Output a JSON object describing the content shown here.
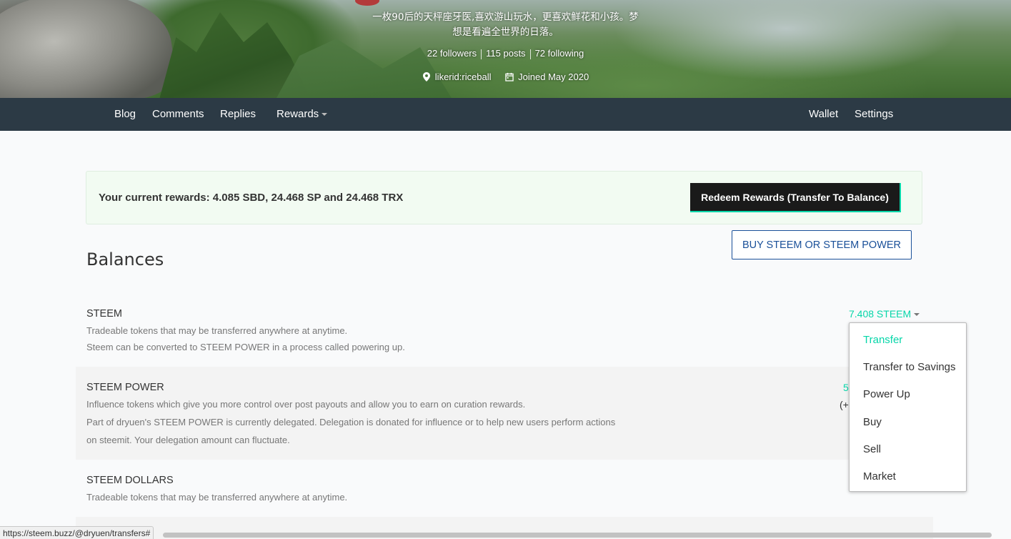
{
  "profile": {
    "bio_line1": "一枚90后的天枰座牙医,喜欢游山玩水，更喜欢鲜花和小孩。梦",
    "bio_line2": "想是看遍全世界的日落。",
    "followers": "22 followers",
    "posts": "115 posts",
    "following": "72 following",
    "location": "likerid:riceball",
    "joined": "Joined May 2020",
    "location_icon": "map-pin-icon",
    "calendar_icon": "calendar-icon"
  },
  "nav": {
    "blog": "Blog",
    "comments": "Comments",
    "replies": "Replies",
    "rewards": "Rewards",
    "wallet": "Wallet",
    "settings": "Settings"
  },
  "rewards": {
    "text": "Your current rewards: 4.085 SBD, 24.468 SP and 24.468 TRX",
    "redeem_label": "Redeem Rewards (Transfer To Balance)"
  },
  "buy_label": "BUY STEEM OR STEEM POWER",
  "balances": {
    "title": "Balances",
    "steem": {
      "name": "STEEM",
      "desc1": "Tradeable tokens that may be transferred anywhere at anytime.",
      "desc2": "Steem can be converted to STEEM POWER in a process called powering up.",
      "amount": "7.408 STEEM"
    },
    "steem_power": {
      "name": "STEEM POWER",
      "desc1": "Influence tokens which give you more control over post payouts and allow you to earn on curation rewards.",
      "desc2": "Part of dryuen's STEEM POWER is currently delegated. Delegation is donated for influence or to help new users perform actions",
      "desc3": "on steemit. Your delegation amount can fluctuate.",
      "amount_partial": "5",
      "delegated_partial": "(+"
    },
    "steem_dollars": {
      "name": "STEEM DOLLARS",
      "desc1": "Tradeable tokens that may be transferred anywhere at anytime."
    }
  },
  "dropdown": [
    "Transfer",
    "Transfer to Savings",
    "Power Up",
    "Buy",
    "Sell",
    "Market"
  ],
  "status_url": "https://steem.buzz/@dryuen/transfers#",
  "colors": {
    "accent": "#06d6a9",
    "nav_bg": "#2c3a45",
    "buy_blue": "#1a5099",
    "rewards_bg": "#f2fbf2"
  }
}
